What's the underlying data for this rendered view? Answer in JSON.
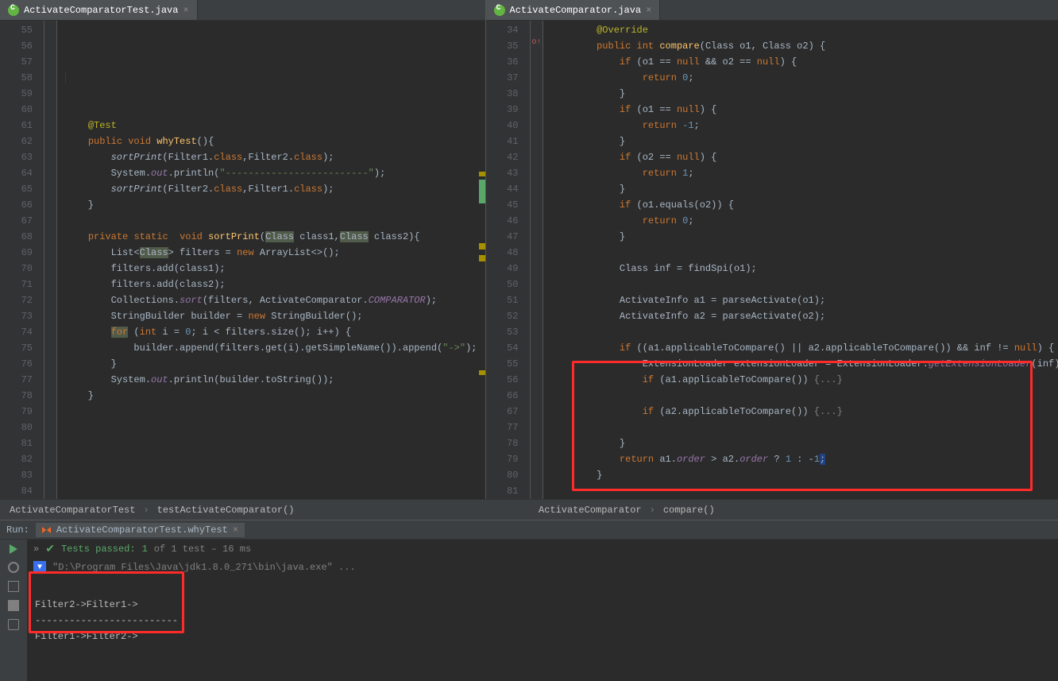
{
  "tabs": {
    "left": "ActivateComparatorTest.java",
    "right": "ActivateComparator.java"
  },
  "leftGutterStart": 55,
  "leftGutterEnd": 84,
  "rightLines": [
    "34",
    "35",
    "36",
    "37",
    "38",
    "39",
    "40",
    "41",
    "42",
    "43",
    "44",
    "45",
    "46",
    "47",
    "48",
    "49",
    "50",
    "51",
    "52",
    "53",
    "54",
    "55",
    "56",
    "66",
    "67",
    "77",
    "78",
    "79",
    "80",
    "81"
  ],
  "leftCode": {
    "testAnn": "@Test",
    "pub": "public",
    "void": "void",
    "why": "whyTest",
    "lp": "(){",
    "sp1a": "sortPrint",
    "sp1b": "(Filter1.",
    "sp1c": "class",
    "sp1d": ",Filter2.",
    "sp1e": "class",
    "sp1f": ");",
    "sys": "System.",
    "out": "out",
    "pln": ".println(",
    "dash": "\"-------------------------\"",
    "end": ");",
    "sp2a": "sortPrint",
    "sp2b": "(Filter2.",
    "sp2c": "class",
    "sp2d": ",Filter1.",
    "sp2e": "class",
    "sp2f": ");",
    "rb": "}",
    "priv": "private",
    "stat": "static",
    "void2": "void",
    "sort": "sortPrint",
    "par": "(",
    "cls": "Class",
    "c1": " class1,",
    "cls2": "Class",
    "c2": " class2){",
    "list": "List<",
    "cls3": "Class",
    "gt": "> filters = ",
    "new": "new",
    "arr": " ArrayList<>();",
    "add1": "filters.add(class1);",
    "add2": "filters.add(class2);",
    "coll": "Collections.",
    "csort": "sort",
    "cargs": "(filters, ActivateComparator.",
    "comp": "COMPARATOR",
    "cend": ");",
    "sb": "StringBuilder builder = ",
    "new2": "new",
    "sb2": " StringBuilder();",
    "for": "for",
    "forp": " (",
    "int": "int",
    "fori": " i = ",
    "z": "0",
    "forc": "; i < filters.size(); i++) {",
    "app": "builder.append(filters.get(i).getSimpleName()).append(",
    "arrow": "\"->\"",
    "app2": ");",
    "rb2": "}",
    "pr": "System.",
    "out2": "out",
    "pr2": ".println(builder.toString());",
    "rb3": "}"
  },
  "rightCode": {
    "ov": "@Override",
    "pub": "public",
    "int": "int",
    "cmp": "compare",
    "args": "(Class o1, Class o2) {",
    "if1": "if",
    "c1": " (o1 == ",
    "nul": "null",
    "c1b": " && o2 == ",
    "c1c": ") {",
    "ret": "return ",
    "z": "0",
    "sc": ";",
    "rb": "}",
    "if2a": " (o1 == ",
    "if2b": ") {",
    "neg1": "-1",
    "if3a": " (o2 == ",
    "if3b": ") {",
    "one": "1",
    "if4": " (o1.equals(o2)) {",
    "inf": "Class<?> inf = findSpi(o1);",
    "a1": "ActivateInfo a1 = parseActivate(o1);",
    "a2": "ActivateInfo a2 = parseActivate(o2);",
    "if5": " ((a1.applicableToCompare() || a2.applicableToCompare()) && inf != ",
    "if5b": ") {",
    "ext": "ExtensionLoader<?> extensionLoader = ExtensionLoader.",
    "gext": "getExtensionLoader",
    "ext2": "(inf);",
    "if6": " (a1.applicableToCompare()) ",
    "fold": "{...}",
    "if7": " (a2.applicableToCompare()) ",
    "retf": " a1.",
    "ord": "order",
    "retf2": " > a2.",
    "retf3": " ? ",
    "retf4": " : -",
    "retf5": ";",
    "caret": "|"
  },
  "breadcrumbs": {
    "leftClass": "ActivateComparatorTest",
    "leftMethod": "testActivateComparator()",
    "rightClass": "ActivateComparator",
    "rightMethod": "compare()"
  },
  "run": {
    "label": "Run:",
    "tab": "ActivateComparatorTest.whyTest",
    "testsPrefix": "Tests passed:",
    "testsGreen": " 1",
    "testsGrey": " of 1 test – 16 ms",
    "cmd": "\"D:\\Program Files\\Java\\jdk1.8.0_271\\bin\\java.exe\" ...",
    "out1": "Filter2->Filter1->",
    "out2": "-------------------------",
    "out3": "Filter1->Filter2->"
  }
}
